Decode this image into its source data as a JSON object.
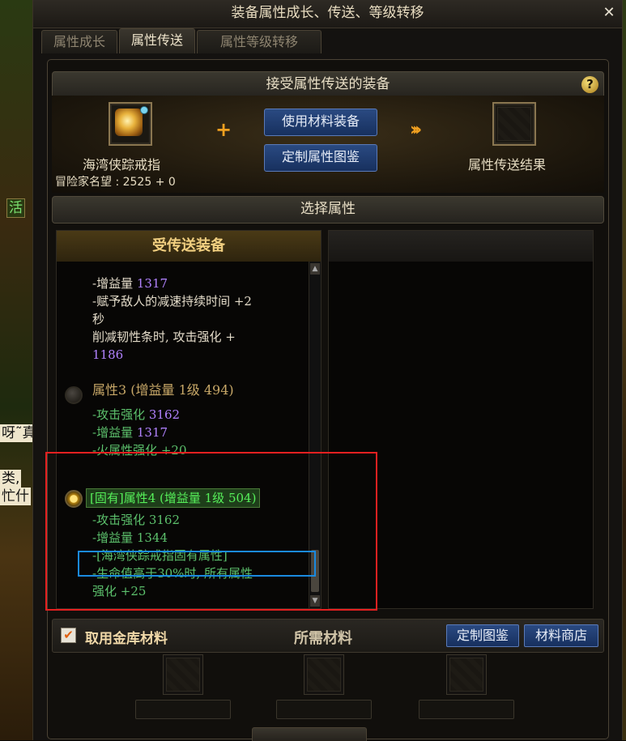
{
  "window": {
    "title": "装备属性成长、传送、等级转移"
  },
  "tabs": [
    {
      "label": "属性成长",
      "active": false
    },
    {
      "label": "属性传送",
      "active": true
    },
    {
      "label": "属性等级转移",
      "active": false
    }
  ],
  "receive_section": {
    "header": "接受属性传送的装备",
    "item_name": "海湾侠踪戒指",
    "reputation": "冒险家名望 : 2525 + 0",
    "use_material_button": "使用材料装备",
    "custom_catalog_button": "定制属性图鉴",
    "result_label": "属性传送结果"
  },
  "select_section": {
    "header": "选择属性",
    "list_header": "受传送装备",
    "lines": {
      "gain_1317a_label": "-增益量",
      "gain_1317a_value": "1317",
      "slow_line1": "-赋予敌人的减速持续时间 +2",
      "slow_line2": "秒",
      "tough_line1": "削减韧性条时, 攻击强化 +",
      "tough_line2": "1186",
      "attr3_title": "属性3 (增益量 1级 494)",
      "attr3_atk_label": "-攻击强化",
      "attr3_atk_value": "3162",
      "attr3_gain_label": "-增益量",
      "attr3_gain_value": "1317",
      "attr3_fire": "-火属性强化 +20",
      "attr4_title": "[固有]属性4 (增益量 1级 504)",
      "attr4_atk": "-攻击强化 3162",
      "attr4_gain": "-增益量 1344",
      "attr4_inherent": "-[海湾侠踪戒指固有属性]",
      "attr4_hp_line1": "-生命值高于30%时, 所有属性",
      "attr4_hp_line2": "强化 +25"
    }
  },
  "materials": {
    "use_vault_label": "取用金库材料",
    "use_vault_checked": true,
    "required_label": "所需材料",
    "custom_catalog_button": "定制图鉴",
    "material_shop_button": "材料商店"
  },
  "background_fragments": {
    "f1": "呀˜真",
    "f2": "类,",
    "f3": "忙什",
    "f4": "活"
  },
  "colors": {
    "highlight_red": "#e42020",
    "highlight_blue": "#1a8ae0",
    "fixed_green": "#56f05a",
    "purple_value": "#b182ff"
  }
}
